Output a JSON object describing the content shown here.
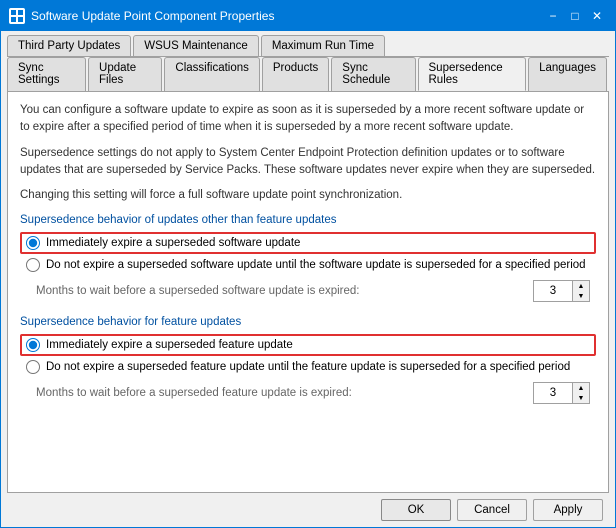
{
  "window": {
    "title": "Software Update Point Component Properties",
    "icon_label": "SW"
  },
  "tabs_row1": {
    "items": [
      {
        "label": "Third Party Updates",
        "active": false
      },
      {
        "label": "WSUS Maintenance",
        "active": false
      },
      {
        "label": "Maximum Run Time",
        "active": false
      }
    ]
  },
  "tabs_row2": {
    "items": [
      {
        "label": "Sync Settings",
        "active": false
      },
      {
        "label": "Update Files",
        "active": false
      },
      {
        "label": "Classifications",
        "active": false
      },
      {
        "label": "Products",
        "active": false
      },
      {
        "label": "Sync Schedule",
        "active": false
      },
      {
        "label": "Supersedence Rules",
        "active": true
      },
      {
        "label": "Languages",
        "active": false
      }
    ]
  },
  "description": {
    "para1": "You can configure a software update to expire as soon as it is superseded by a more recent software update or to expire after a specified period of time when it is superseded by a more recent software update.",
    "para2": "Supersedence settings do not apply to System Center Endpoint Protection definition updates or to software updates that are superseded by Service Packs. These software updates never expire when they are superseded.",
    "para3": "Changing this setting will force a full software update point synchronization."
  },
  "section1": {
    "label": "Supersedence behavior of updates other than feature updates",
    "option1_label": "Immediately expire a superseded software update",
    "option1_checked": true,
    "option2_label": "Do not expire a superseded software update until the software update is superseded for a specified period",
    "option2_checked": false,
    "spinner_label": "Months to wait before a superseded software update is expired:",
    "spinner_value": "3"
  },
  "section2": {
    "label": "Supersedence behavior for feature updates",
    "option1_label": "Immediately expire a superseded feature update",
    "option1_checked": true,
    "option2_label": "Do not expire a superseded feature update until the feature update is superseded for a specified period",
    "option2_checked": false,
    "spinner_label": "Months to wait before a superseded feature update is expired:",
    "spinner_value": "3"
  },
  "buttons": {
    "ok": "OK",
    "cancel": "Cancel",
    "apply": "Apply"
  }
}
